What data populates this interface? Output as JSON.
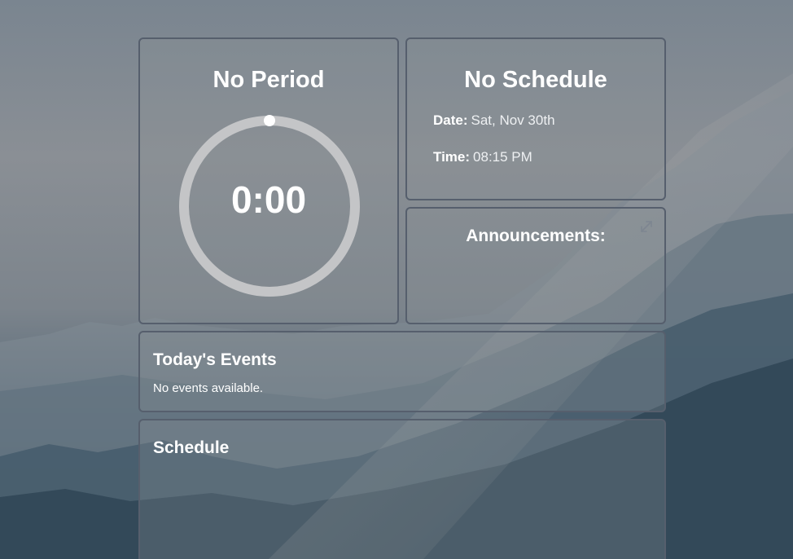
{
  "timer": {
    "period_title": "No Period",
    "countdown": "0:00",
    "progress": 0
  },
  "schedule_info": {
    "title": "No Schedule",
    "date_label": "Date:",
    "date_value": "Sat, Nov 30th",
    "time_label": "Time:",
    "time_value": "08:15 PM"
  },
  "announcements": {
    "title": "Announcements:",
    "expand_icon": "expand-icon"
  },
  "events": {
    "title": "Today's Events",
    "empty_message": "No events available."
  },
  "schedule": {
    "title": "Schedule"
  },
  "colors": {
    "panel_border": "#565f6d",
    "ring_track": "#c4c5c7",
    "ring_indicator": "#ffffff",
    "text": "#ffffff"
  }
}
